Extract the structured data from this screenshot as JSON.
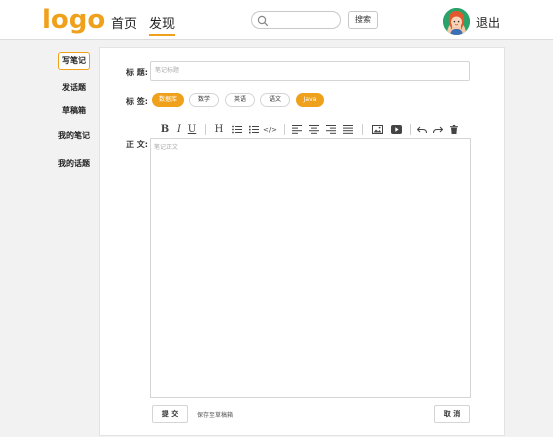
{
  "header": {
    "logo": "logo",
    "nav_home": "首页",
    "nav_find": "发现",
    "search_placeholder": "",
    "search_button": "搜索",
    "logout": "退出",
    "accent_color": "#f0a11c"
  },
  "sidebar": {
    "items": [
      {
        "label": "写笔记",
        "active": true
      },
      {
        "label": "发话题"
      },
      {
        "label": "草稿箱"
      },
      {
        "label": "我的笔记"
      },
      {
        "label": "我的话题"
      }
    ]
  },
  "form": {
    "title_label": "标 题:",
    "title_placeholder": "笔记标题",
    "tags_label": "标 签:",
    "tags": [
      {
        "label": "数据库",
        "active": true
      },
      {
        "label": "数学",
        "active": false
      },
      {
        "label": "英语",
        "active": false
      },
      {
        "label": "语文",
        "active": false
      },
      {
        "label": "Java",
        "active": true
      }
    ],
    "body_label": "正 文:",
    "body_placeholder": "笔记正文",
    "toolbar": {
      "bold": "B",
      "italic": "I",
      "underline": "U",
      "heading": "H",
      "code": "</>"
    },
    "submit_button": "提 交",
    "save_draft": "保存至草稿箱",
    "cancel_button": "取 消"
  }
}
